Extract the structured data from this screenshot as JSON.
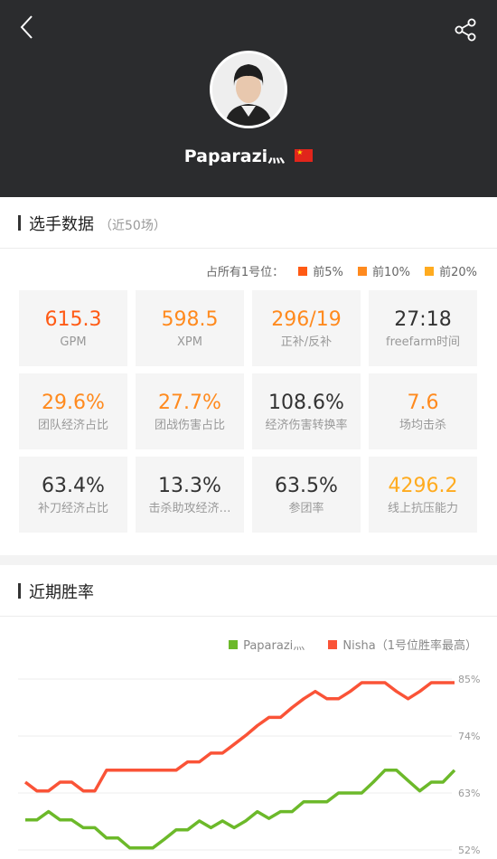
{
  "header": {
    "player_name": "Paparazi灬",
    "flag": "China"
  },
  "icons": {
    "back": "chevron-left-icon",
    "share": "share-icon"
  },
  "stats_section": {
    "title": "选手数据",
    "subtitle": "（近50场）",
    "legend": {
      "prefix": "占所有1号位：",
      "items": [
        {
          "label": "前5%",
          "color": "#ff5a14"
        },
        {
          "label": "前10%",
          "color": "#ff8a1e"
        },
        {
          "label": "前20%",
          "color": "#ffab1f"
        }
      ]
    },
    "stats": [
      {
        "value": "615.3",
        "label": "GPM",
        "color": "#ff5a14"
      },
      {
        "value": "598.5",
        "label": "XPM",
        "color": "#ff8a1e"
      },
      {
        "value": "296/19",
        "label": "正补/反补",
        "color": "#ff8a1e"
      },
      {
        "value": "27:18",
        "label": "freefarm时间",
        "color": "#333333"
      },
      {
        "value": "29.6%",
        "label": "团队经济占比",
        "color": "#ff8a1e"
      },
      {
        "value": "27.7%",
        "label": "团战伤害占比",
        "color": "#ff8a1e"
      },
      {
        "value": "108.6%",
        "label": "经济伤害转换率",
        "color": "#333333"
      },
      {
        "value": "7.6",
        "label": "场均击杀",
        "color": "#ff8a1e"
      },
      {
        "value": "63.4%",
        "label": "补刀经济占比",
        "color": "#333333"
      },
      {
        "value": "13.3%",
        "label": "击杀助攻经济…",
        "color": "#333333"
      },
      {
        "value": "63.5%",
        "label": "参团率",
        "color": "#333333"
      },
      {
        "value": "4296.2",
        "label": "线上抗压能力",
        "color": "#ffab1f"
      }
    ]
  },
  "winrate_section": {
    "title": "近期胜率"
  },
  "chart_data": {
    "type": "line",
    "y_tick_labels": [
      "85%",
      "74%",
      "63%",
      "52%"
    ],
    "ylim": [
      52,
      85
    ],
    "legend_position": "top-right",
    "series": [
      {
        "name": "Paparazi灬",
        "color": "#6cb92a",
        "values": [
          57.8,
          57.8,
          59.4,
          57.8,
          57.8,
          56.3,
          56.3,
          54.3,
          54.3,
          52.4,
          52.4,
          52.4,
          54.1,
          55.9,
          55.9,
          57.6,
          56.3,
          57.6,
          56.3,
          57.6,
          59.4,
          58.1,
          59.4,
          59.4,
          61.3,
          61.3,
          61.3,
          63.0,
          63.0,
          63.0,
          65.1,
          67.4,
          67.4,
          65.4,
          63.4,
          65.1,
          65.1,
          67.4
        ]
      },
      {
        "name": "Nisha（1号位胜率最高）",
        "color": "#fa5337",
        "values": [
          65.1,
          63.4,
          63.4,
          65.1,
          65.1,
          63.4,
          63.4,
          67.4,
          67.4,
          67.4,
          67.4,
          67.4,
          67.4,
          67.4,
          69.0,
          69.0,
          70.7,
          70.7,
          72.4,
          74.1,
          76.0,
          77.6,
          77.6,
          79.5,
          81.2,
          82.6,
          81.2,
          81.2,
          82.6,
          84.3,
          84.3,
          84.3,
          82.6,
          81.2,
          82.6,
          84.3,
          84.3,
          84.3
        ]
      }
    ]
  }
}
